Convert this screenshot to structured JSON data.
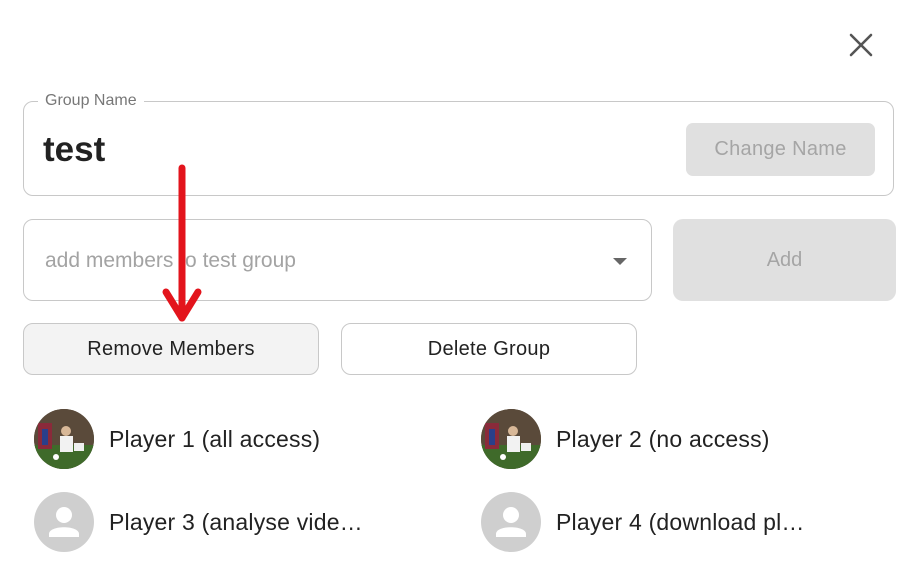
{
  "dialog": {
    "close_icon": "close-icon",
    "group_name_legend": "Group Name",
    "group_name": "test",
    "change_name_label": "Change Name",
    "add_members_placeholder": "add members to test group",
    "add_label": "Add",
    "remove_members_label": "Remove Members",
    "delete_group_label": "Delete Group"
  },
  "members": [
    {
      "name": "Player 1 (all access)",
      "avatar": "photo"
    },
    {
      "name": "Player 2 (no access)",
      "avatar": "photo"
    },
    {
      "name": "Player 3 (analyse vide…",
      "avatar": "default-person-icon"
    },
    {
      "name": "Player 4 (download pl…",
      "avatar": "default-person-icon"
    }
  ],
  "annotation": {
    "arrow_color": "#e3141c"
  },
  "colors": {
    "disabled_button_bg": "#e0e0e0",
    "disabled_button_text": "#a5a5a5",
    "border": "#c8c8c8"
  }
}
